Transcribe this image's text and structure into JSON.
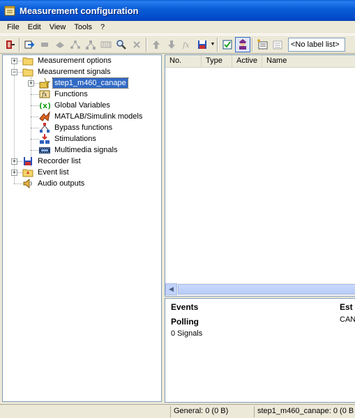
{
  "window": {
    "title": "Measurement configuration"
  },
  "menu": [
    "File",
    "Edit",
    "View",
    "Tools",
    "?"
  ],
  "toolbar": {
    "label_list_value": "<No label list>",
    "buttons": [
      "exit-icon",
      "import-icon",
      "tool-icon",
      "tool-icon",
      "network-icon",
      "network-icon",
      "grid-icon",
      "search-icon",
      "delete-icon",
      "move-up-icon",
      "move-down-icon",
      "function-icon",
      "save-icon",
      "check-icon",
      "user-icon",
      "add-list-icon",
      "list-icon"
    ]
  },
  "tree": {
    "items": [
      {
        "label": "Measurement options",
        "icon": "folder-icon",
        "expander": "+"
      },
      {
        "label": "Measurement signals",
        "icon": "folder-icon",
        "expander": "-"
      },
      {
        "label": "step1_m460_canape",
        "icon": "device-icon",
        "expander": "+",
        "selected": true
      },
      {
        "label": "Functions",
        "icon": "function-icon"
      },
      {
        "label": "Global Variables",
        "icon": "variable-icon"
      },
      {
        "label": "MATLAB/Simulink models",
        "icon": "matlab-icon"
      },
      {
        "label": "Bypass functions",
        "icon": "bypass-icon"
      },
      {
        "label": "Stimulations",
        "icon": "stimulation-icon"
      },
      {
        "label": "Multimedia signals",
        "icon": "film-icon"
      },
      {
        "label": "Recorder list",
        "icon": "disk-icon",
        "expander": "+"
      },
      {
        "label": "Event list",
        "icon": "event-icon",
        "expander": "+"
      },
      {
        "label": "Audio outputs",
        "icon": "speaker-icon"
      }
    ]
  },
  "list": {
    "columns": [
      "No.",
      "Type",
      "Active",
      "Name"
    ]
  },
  "info": {
    "events_label": "Events",
    "est_label": "Est",
    "polling_label": "Polling",
    "can_label": "CAN",
    "signals_label": "0 Signals"
  },
  "status": {
    "general": "General:  0 (0 B)",
    "device": "step1_m460_canape: 0 (0 B"
  },
  "colors": {
    "titlebar": "#0a5fd8",
    "selection": "#316ac5"
  }
}
